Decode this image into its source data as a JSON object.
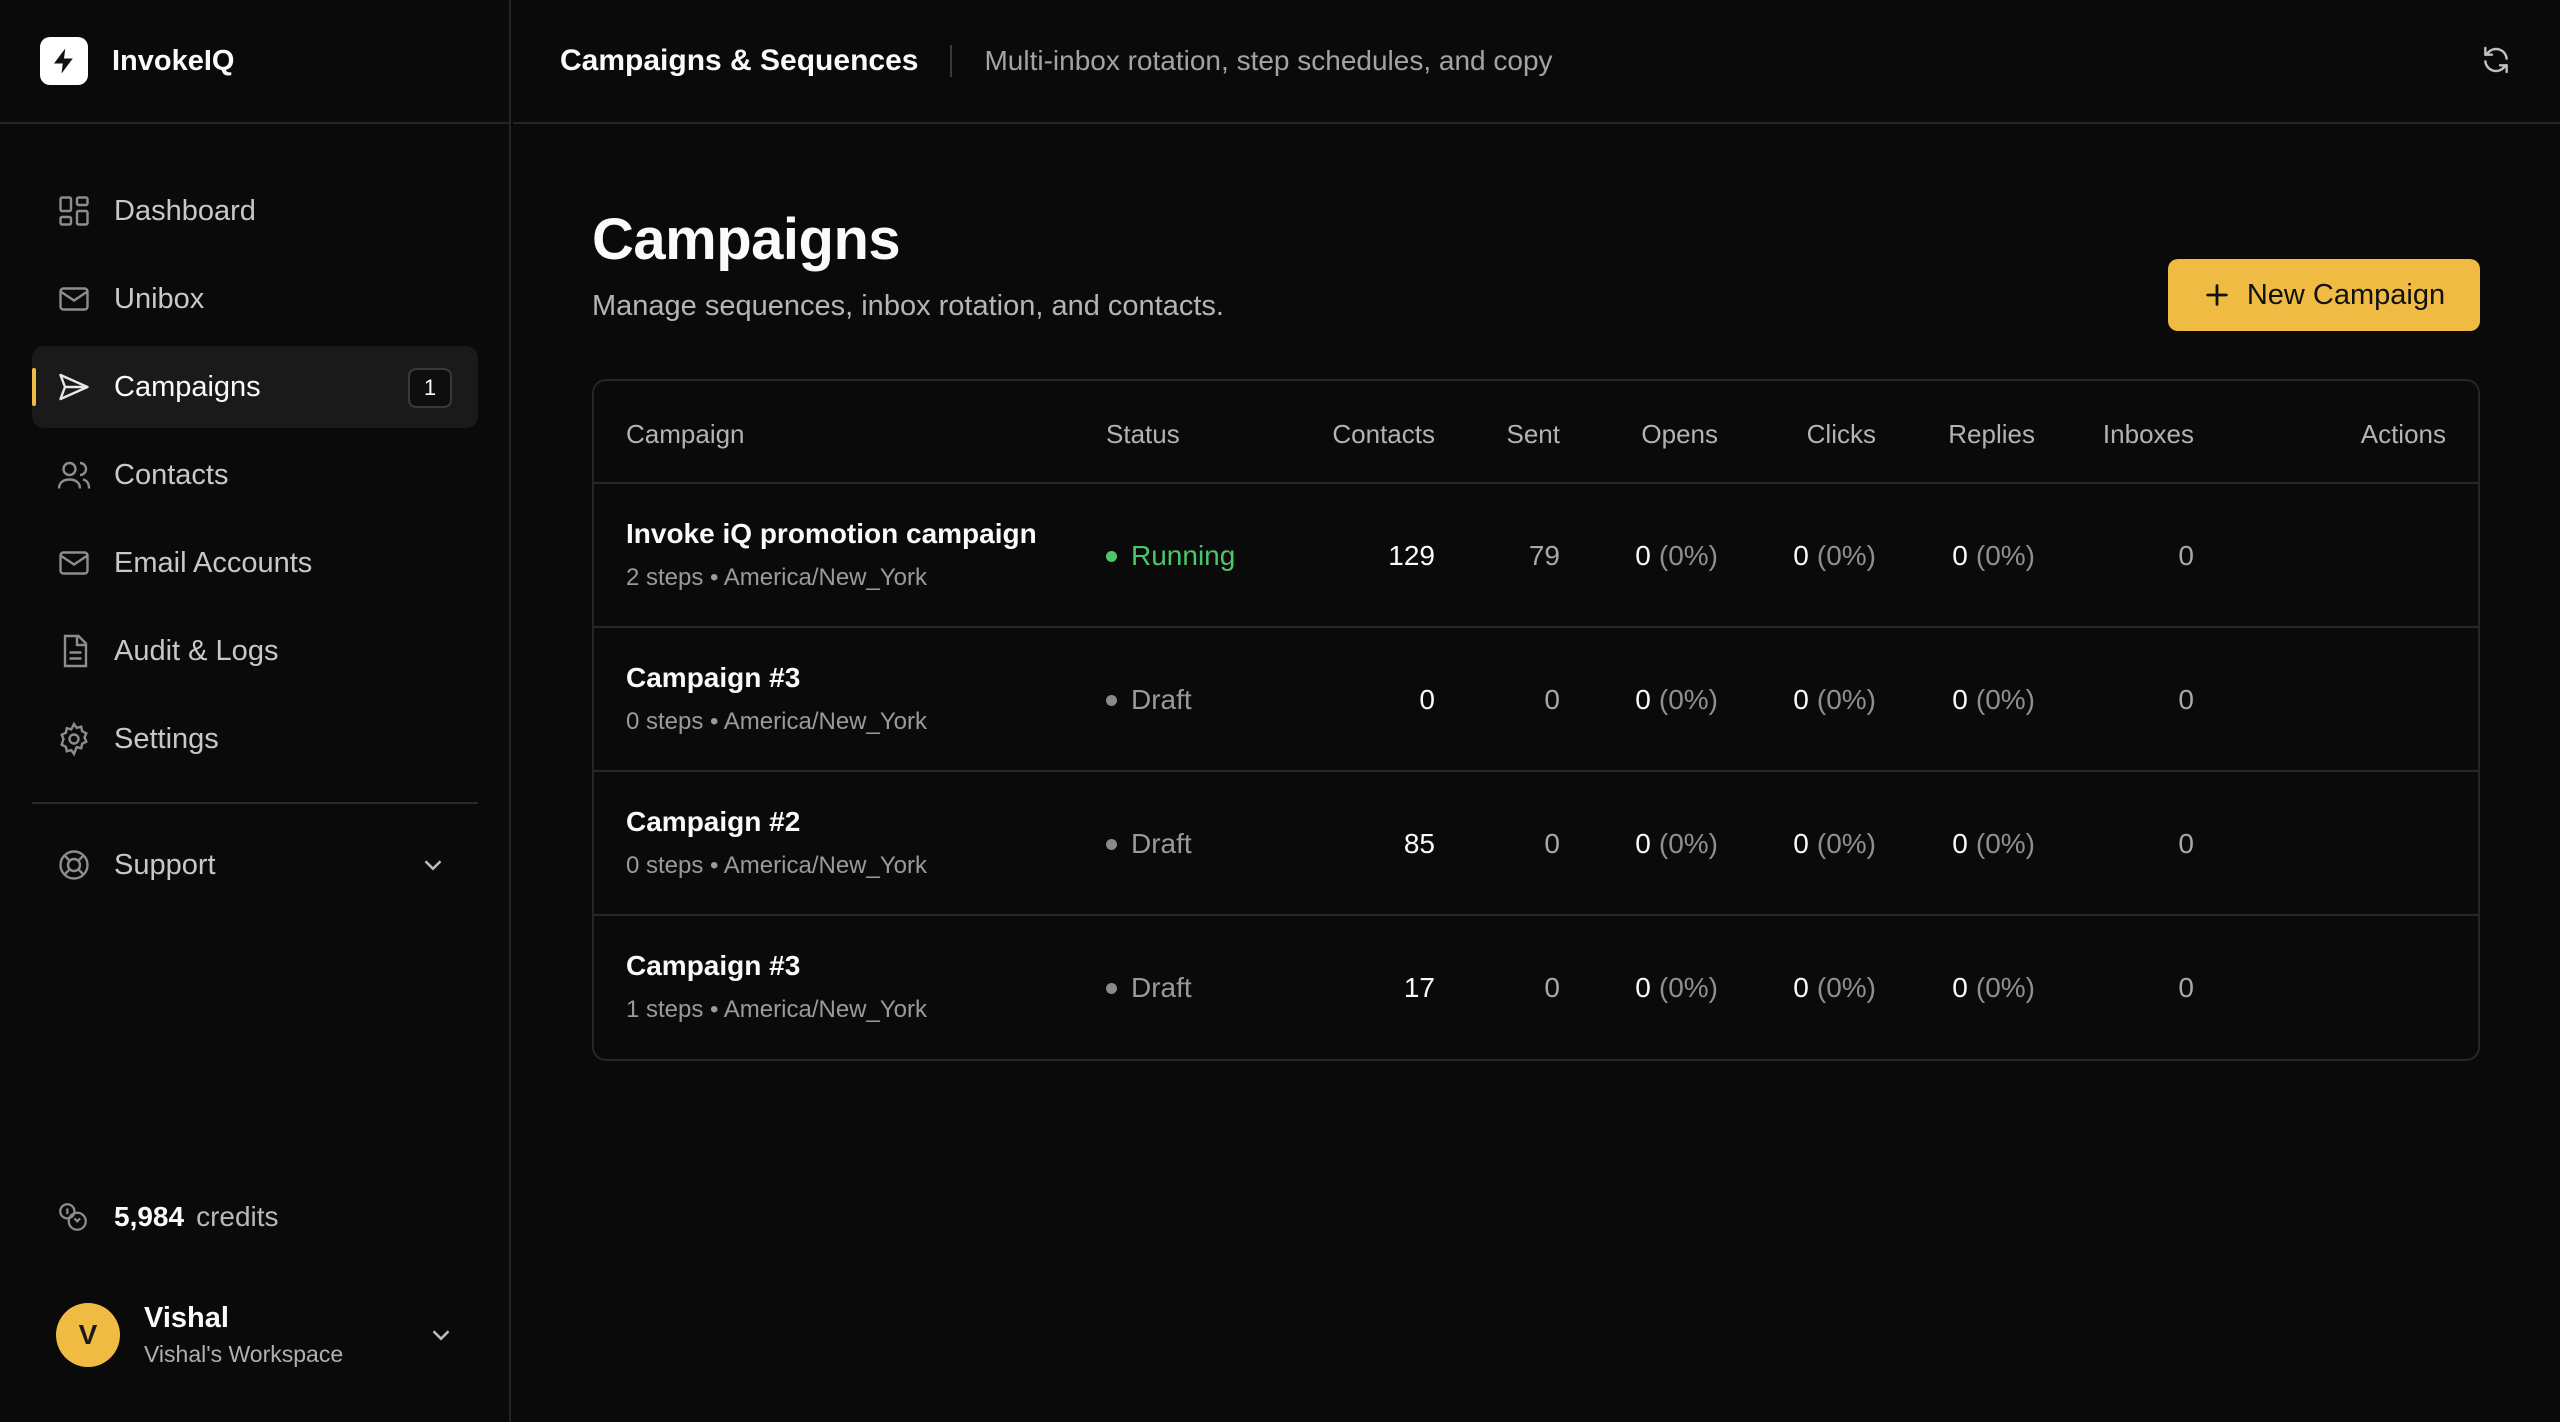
{
  "brand": {
    "name": "InvokeIQ"
  },
  "sidebar": {
    "items": [
      {
        "label": "Dashboard"
      },
      {
        "label": "Unibox"
      },
      {
        "label": "Campaigns",
        "badge": "1"
      },
      {
        "label": "Contacts"
      },
      {
        "label": "Email Accounts"
      },
      {
        "label": "Audit & Logs"
      },
      {
        "label": "Settings"
      }
    ],
    "support": {
      "label": "Support"
    },
    "credits": {
      "value": "5,984",
      "unit": "credits"
    },
    "user": {
      "initial": "V",
      "name": "Vishal",
      "workspace": "Vishal's Workspace"
    }
  },
  "header": {
    "title": "Campaigns & Sequences",
    "subtitle": "Multi-inbox rotation, step schedules, and copy"
  },
  "main": {
    "title": "Campaigns",
    "subtitle": "Manage sequences, inbox rotation, and contacts.",
    "new_button": "New Campaign",
    "columns": [
      "Campaign",
      "Status",
      "Contacts",
      "Sent",
      "Opens",
      "Clicks",
      "Replies",
      "Inboxes",
      "Actions"
    ],
    "rows": [
      {
        "name": "Invoke iQ promotion campaign",
        "meta": "2 steps • America/New_York",
        "status": "Running",
        "contacts": "129",
        "sent": "79",
        "opens": "0",
        "opens_pct": "(0%)",
        "clicks": "0",
        "clicks_pct": "(0%)",
        "replies": "0",
        "replies_pct": "(0%)",
        "inboxes": "0"
      },
      {
        "name": "Campaign #3",
        "meta": "0 steps • America/New_York",
        "status": "Draft",
        "contacts": "0",
        "sent": "0",
        "opens": "0",
        "opens_pct": "(0%)",
        "clicks": "0",
        "clicks_pct": "(0%)",
        "replies": "0",
        "replies_pct": "(0%)",
        "inboxes": "0"
      },
      {
        "name": "Campaign #2",
        "meta": "0 steps • America/New_York",
        "status": "Draft",
        "contacts": "85",
        "sent": "0",
        "opens": "0",
        "opens_pct": "(0%)",
        "clicks": "0",
        "clicks_pct": "(0%)",
        "replies": "0",
        "replies_pct": "(0%)",
        "inboxes": "0"
      },
      {
        "name": "Campaign #3",
        "meta": "1 steps • America/New_York",
        "status": "Draft",
        "contacts": "17",
        "sent": "0",
        "opens": "0",
        "opens_pct": "(0%)",
        "clicks": "0",
        "clicks_pct": "(0%)",
        "replies": "0",
        "replies_pct": "(0%)",
        "inboxes": "0"
      }
    ]
  },
  "colors": {
    "accent": "#f0bb43",
    "running": "#4ec46b",
    "background": "#0a0a0a"
  }
}
